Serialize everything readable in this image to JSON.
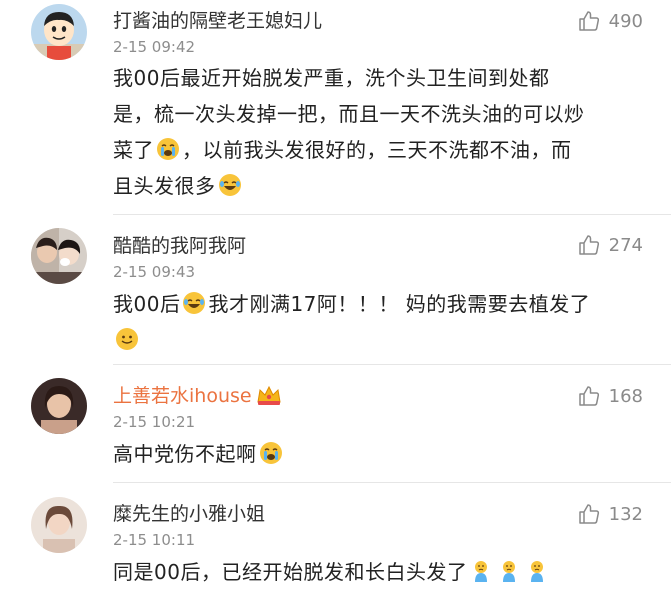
{
  "comments": [
    {
      "username": "打酱油的隔壁老王媳妇儿",
      "time": "2-15 09:42",
      "likes": "490",
      "lines": [
        "我00后最近开始脱发严重，洗个头卫生间到处都",
        "是，梳一次头发掉一把，而且一天不洗头油的可以炒",
        "菜了",
        "，以前我头发很好的，三天不洗都不油，而",
        "且头发很多"
      ],
      "avatar_icon": "cartoon-boy-avatar"
    },
    {
      "username": "酷酷的我阿我阿",
      "time": "2-15 09:43",
      "likes": "274",
      "text_a": "我00后",
      "text_b": "我才刚满17阿！！！ 妈的我需要去植发了",
      "avatar_icon": "couple-photo-avatar"
    },
    {
      "username": "上善若水ihouse",
      "time": "2-15 10:21",
      "likes": "168",
      "text": "高中党伤不起啊",
      "badge_icon": "vip-crown-icon",
      "name_color": "#eb7340"
    },
    {
      "username": "糜先生的小雅小姐",
      "time": "2-15 10:11",
      "likes": "132",
      "text": "同是00后，已经开始脱发和长白头发了"
    }
  ],
  "colors": {
    "text": "#222222",
    "meta": "#8d8d8d",
    "vip_name": "#eb7340",
    "emoji_yellow": "#f8c43a"
  },
  "icons": {
    "like": "thumb-up-icon",
    "crying": "crying-emoji-icon",
    "laughing": "laughing-tears-emoji-icon",
    "smile": "smile-emoji-icon",
    "sad_figure": "sad-figure-emoji-icon"
  }
}
